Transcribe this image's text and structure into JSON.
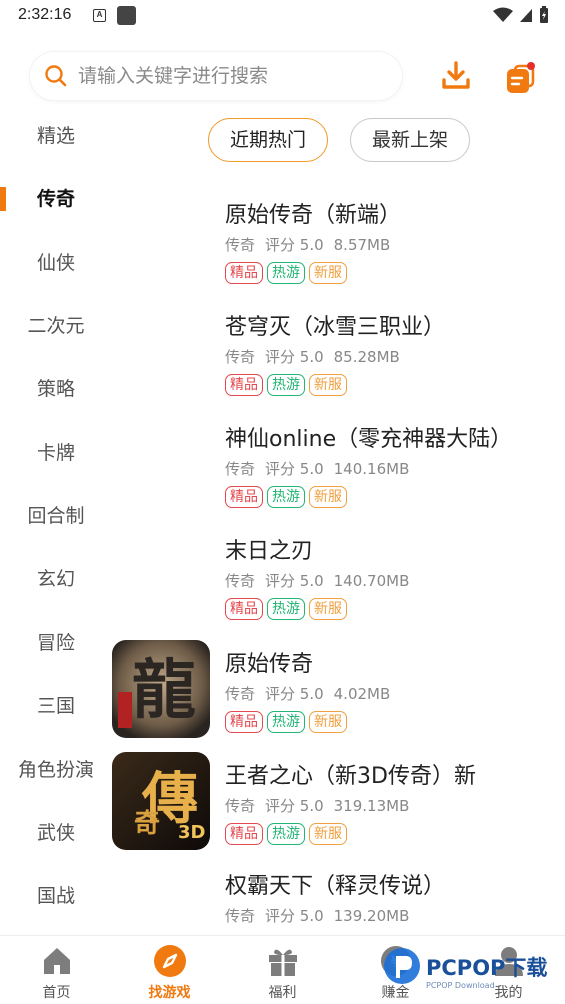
{
  "status": {
    "time": "2:32:16",
    "a_icon": "A"
  },
  "search": {
    "placeholder": "请输入关键字进行搜索"
  },
  "colors": {
    "accent": "#f07a10",
    "tag_jing": "#e5484d",
    "tag_re": "#22b573",
    "tag_xin": "#f0a040"
  },
  "categories": [
    "精选",
    "传奇",
    "仙侠",
    "二次元",
    "策略",
    "卡牌",
    "回合制",
    "玄幻",
    "冒险",
    "三国",
    "角色扮演",
    "武侠",
    "国战"
  ],
  "active_category": "传奇",
  "filters": {
    "hot": "近期热门",
    "newest": "最新上架"
  },
  "games": [
    {
      "name": "原始传奇（新端）",
      "genre": "传奇",
      "rating": "评分 5.0",
      "size": "8.57MB",
      "icon": ""
    },
    {
      "name": "苍穹灭（冰雪三职业）",
      "genre": "传奇",
      "rating": "评分 5.0",
      "size": "85.28MB",
      "icon": ""
    },
    {
      "name": "神仙online（零充神器大陆）",
      "genre": "传奇",
      "rating": "评分 5.0",
      "size": "140.16MB",
      "icon": ""
    },
    {
      "name": "末日之刃",
      "genre": "传奇",
      "rating": "评分 5.0",
      "size": "140.70MB",
      "icon": ""
    },
    {
      "name": "原始传奇",
      "genre": "传奇",
      "rating": "评分 5.0",
      "size": "4.02MB",
      "icon": "dragon-logo-icon"
    },
    {
      "name": "王者之心（新3D传奇）新",
      "genre": "传奇",
      "rating": "评分 5.0",
      "size": "319.13MB",
      "icon": "chuanqi-3d-logo-icon"
    },
    {
      "name": "权霸天下（释灵传说）",
      "genre": "传奇",
      "rating": "评分 5.0",
      "size": "139.20MB",
      "icon": ""
    }
  ],
  "tags": {
    "jing": "精品",
    "re": "热游",
    "xin": "新服"
  },
  "nav": {
    "home": "首页",
    "find": "找游戏",
    "welfare": "福利",
    "earn": "赚金",
    "mine": "我的"
  },
  "watermark": {
    "brand": "PCPOP下载",
    "sub": "PCPOP Download"
  }
}
